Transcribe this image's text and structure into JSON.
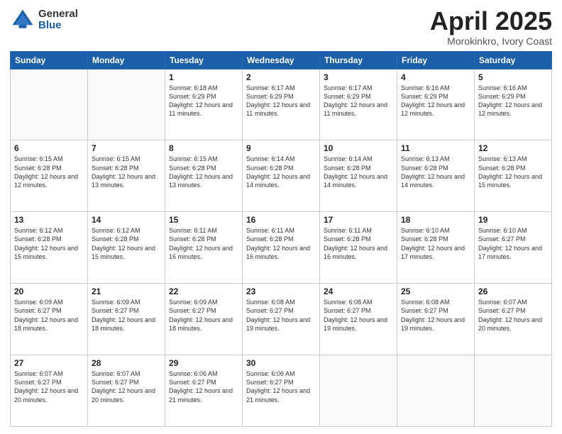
{
  "logo": {
    "general": "General",
    "blue": "Blue"
  },
  "title": {
    "month": "April 2025",
    "location": "Morokinkro, Ivory Coast"
  },
  "weekdays": [
    "Sunday",
    "Monday",
    "Tuesday",
    "Wednesday",
    "Thursday",
    "Friday",
    "Saturday"
  ],
  "weeks": [
    [
      {
        "day": "",
        "info": ""
      },
      {
        "day": "",
        "info": ""
      },
      {
        "day": "1",
        "info": "Sunrise: 6:18 AM\nSunset: 6:29 PM\nDaylight: 12 hours and 11 minutes."
      },
      {
        "day": "2",
        "info": "Sunrise: 6:17 AM\nSunset: 6:29 PM\nDaylight: 12 hours and 11 minutes."
      },
      {
        "day": "3",
        "info": "Sunrise: 6:17 AM\nSunset: 6:29 PM\nDaylight: 12 hours and 11 minutes."
      },
      {
        "day": "4",
        "info": "Sunrise: 6:16 AM\nSunset: 6:29 PM\nDaylight: 12 hours and 12 minutes."
      },
      {
        "day": "5",
        "info": "Sunrise: 6:16 AM\nSunset: 6:29 PM\nDaylight: 12 hours and 12 minutes."
      }
    ],
    [
      {
        "day": "6",
        "info": "Sunrise: 6:15 AM\nSunset: 6:28 PM\nDaylight: 12 hours and 12 minutes."
      },
      {
        "day": "7",
        "info": "Sunrise: 6:15 AM\nSunset: 6:28 PM\nDaylight: 12 hours and 13 minutes."
      },
      {
        "day": "8",
        "info": "Sunrise: 6:15 AM\nSunset: 6:28 PM\nDaylight: 12 hours and 13 minutes."
      },
      {
        "day": "9",
        "info": "Sunrise: 6:14 AM\nSunset: 6:28 PM\nDaylight: 12 hours and 14 minutes."
      },
      {
        "day": "10",
        "info": "Sunrise: 6:14 AM\nSunset: 6:28 PM\nDaylight: 12 hours and 14 minutes."
      },
      {
        "day": "11",
        "info": "Sunrise: 6:13 AM\nSunset: 6:28 PM\nDaylight: 12 hours and 14 minutes."
      },
      {
        "day": "12",
        "info": "Sunrise: 6:13 AM\nSunset: 6:28 PM\nDaylight: 12 hours and 15 minutes."
      }
    ],
    [
      {
        "day": "13",
        "info": "Sunrise: 6:12 AM\nSunset: 6:28 PM\nDaylight: 12 hours and 15 minutes."
      },
      {
        "day": "14",
        "info": "Sunrise: 6:12 AM\nSunset: 6:28 PM\nDaylight: 12 hours and 15 minutes."
      },
      {
        "day": "15",
        "info": "Sunrise: 6:11 AM\nSunset: 6:28 PM\nDaylight: 12 hours and 16 minutes."
      },
      {
        "day": "16",
        "info": "Sunrise: 6:11 AM\nSunset: 6:28 PM\nDaylight: 12 hours and 16 minutes."
      },
      {
        "day": "17",
        "info": "Sunrise: 6:11 AM\nSunset: 6:28 PM\nDaylight: 12 hours and 16 minutes."
      },
      {
        "day": "18",
        "info": "Sunrise: 6:10 AM\nSunset: 6:28 PM\nDaylight: 12 hours and 17 minutes."
      },
      {
        "day": "19",
        "info": "Sunrise: 6:10 AM\nSunset: 6:27 PM\nDaylight: 12 hours and 17 minutes."
      }
    ],
    [
      {
        "day": "20",
        "info": "Sunrise: 6:09 AM\nSunset: 6:27 PM\nDaylight: 12 hours and 18 minutes."
      },
      {
        "day": "21",
        "info": "Sunrise: 6:09 AM\nSunset: 6:27 PM\nDaylight: 12 hours and 18 minutes."
      },
      {
        "day": "22",
        "info": "Sunrise: 6:09 AM\nSunset: 6:27 PM\nDaylight: 12 hours and 18 minutes."
      },
      {
        "day": "23",
        "info": "Sunrise: 6:08 AM\nSunset: 6:27 PM\nDaylight: 12 hours and 19 minutes."
      },
      {
        "day": "24",
        "info": "Sunrise: 6:08 AM\nSunset: 6:27 PM\nDaylight: 12 hours and 19 minutes."
      },
      {
        "day": "25",
        "info": "Sunrise: 6:08 AM\nSunset: 6:27 PM\nDaylight: 12 hours and 19 minutes."
      },
      {
        "day": "26",
        "info": "Sunrise: 6:07 AM\nSunset: 6:27 PM\nDaylight: 12 hours and 20 minutes."
      }
    ],
    [
      {
        "day": "27",
        "info": "Sunrise: 6:07 AM\nSunset: 6:27 PM\nDaylight: 12 hours and 20 minutes."
      },
      {
        "day": "28",
        "info": "Sunrise: 6:07 AM\nSunset: 6:27 PM\nDaylight: 12 hours and 20 minutes."
      },
      {
        "day": "29",
        "info": "Sunrise: 6:06 AM\nSunset: 6:27 PM\nDaylight: 12 hours and 21 minutes."
      },
      {
        "day": "30",
        "info": "Sunrise: 6:06 AM\nSunset: 6:27 PM\nDaylight: 12 hours and 21 minutes."
      },
      {
        "day": "",
        "info": ""
      },
      {
        "day": "",
        "info": ""
      },
      {
        "day": "",
        "info": ""
      }
    ]
  ]
}
